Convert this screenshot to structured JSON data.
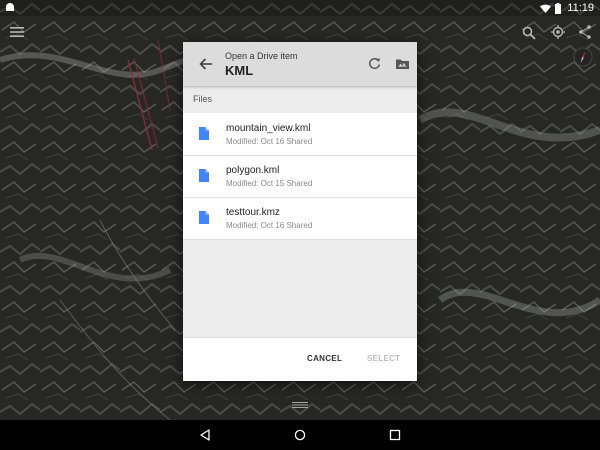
{
  "status_bar": {
    "time": "11:19"
  },
  "dialog": {
    "caption": "Open a Drive item",
    "title": "KML",
    "section_label": "Files",
    "files": [
      {
        "name": "mountain_view.kml",
        "meta": "Modified: Oct 16  Shared"
      },
      {
        "name": "polygon.kml",
        "meta": "Modified: Oct 15  Shared"
      },
      {
        "name": "testtour.kmz",
        "meta": "Modified: Oct 16  Shared"
      }
    ],
    "cancel_label": "CANCEL",
    "select_label": "SELECT"
  },
  "icons": {
    "status_left": "android-notification-icon",
    "wifi": "wifi-icon",
    "battery": "battery-icon",
    "menu": "hamburger-menu-icon",
    "search": "search-icon",
    "location": "my-location-icon",
    "share": "share-icon",
    "compass": "compass-icon",
    "back": "arrow-back-icon",
    "refresh": "refresh-icon",
    "folder": "drive-folder-icon",
    "doc": "document-icon"
  },
  "colors": {
    "doc_icon": "#4285f4",
    "dialog_bg": "#ececec",
    "header_bg": "#dcdcdc",
    "compass_needle": "#e53935"
  }
}
